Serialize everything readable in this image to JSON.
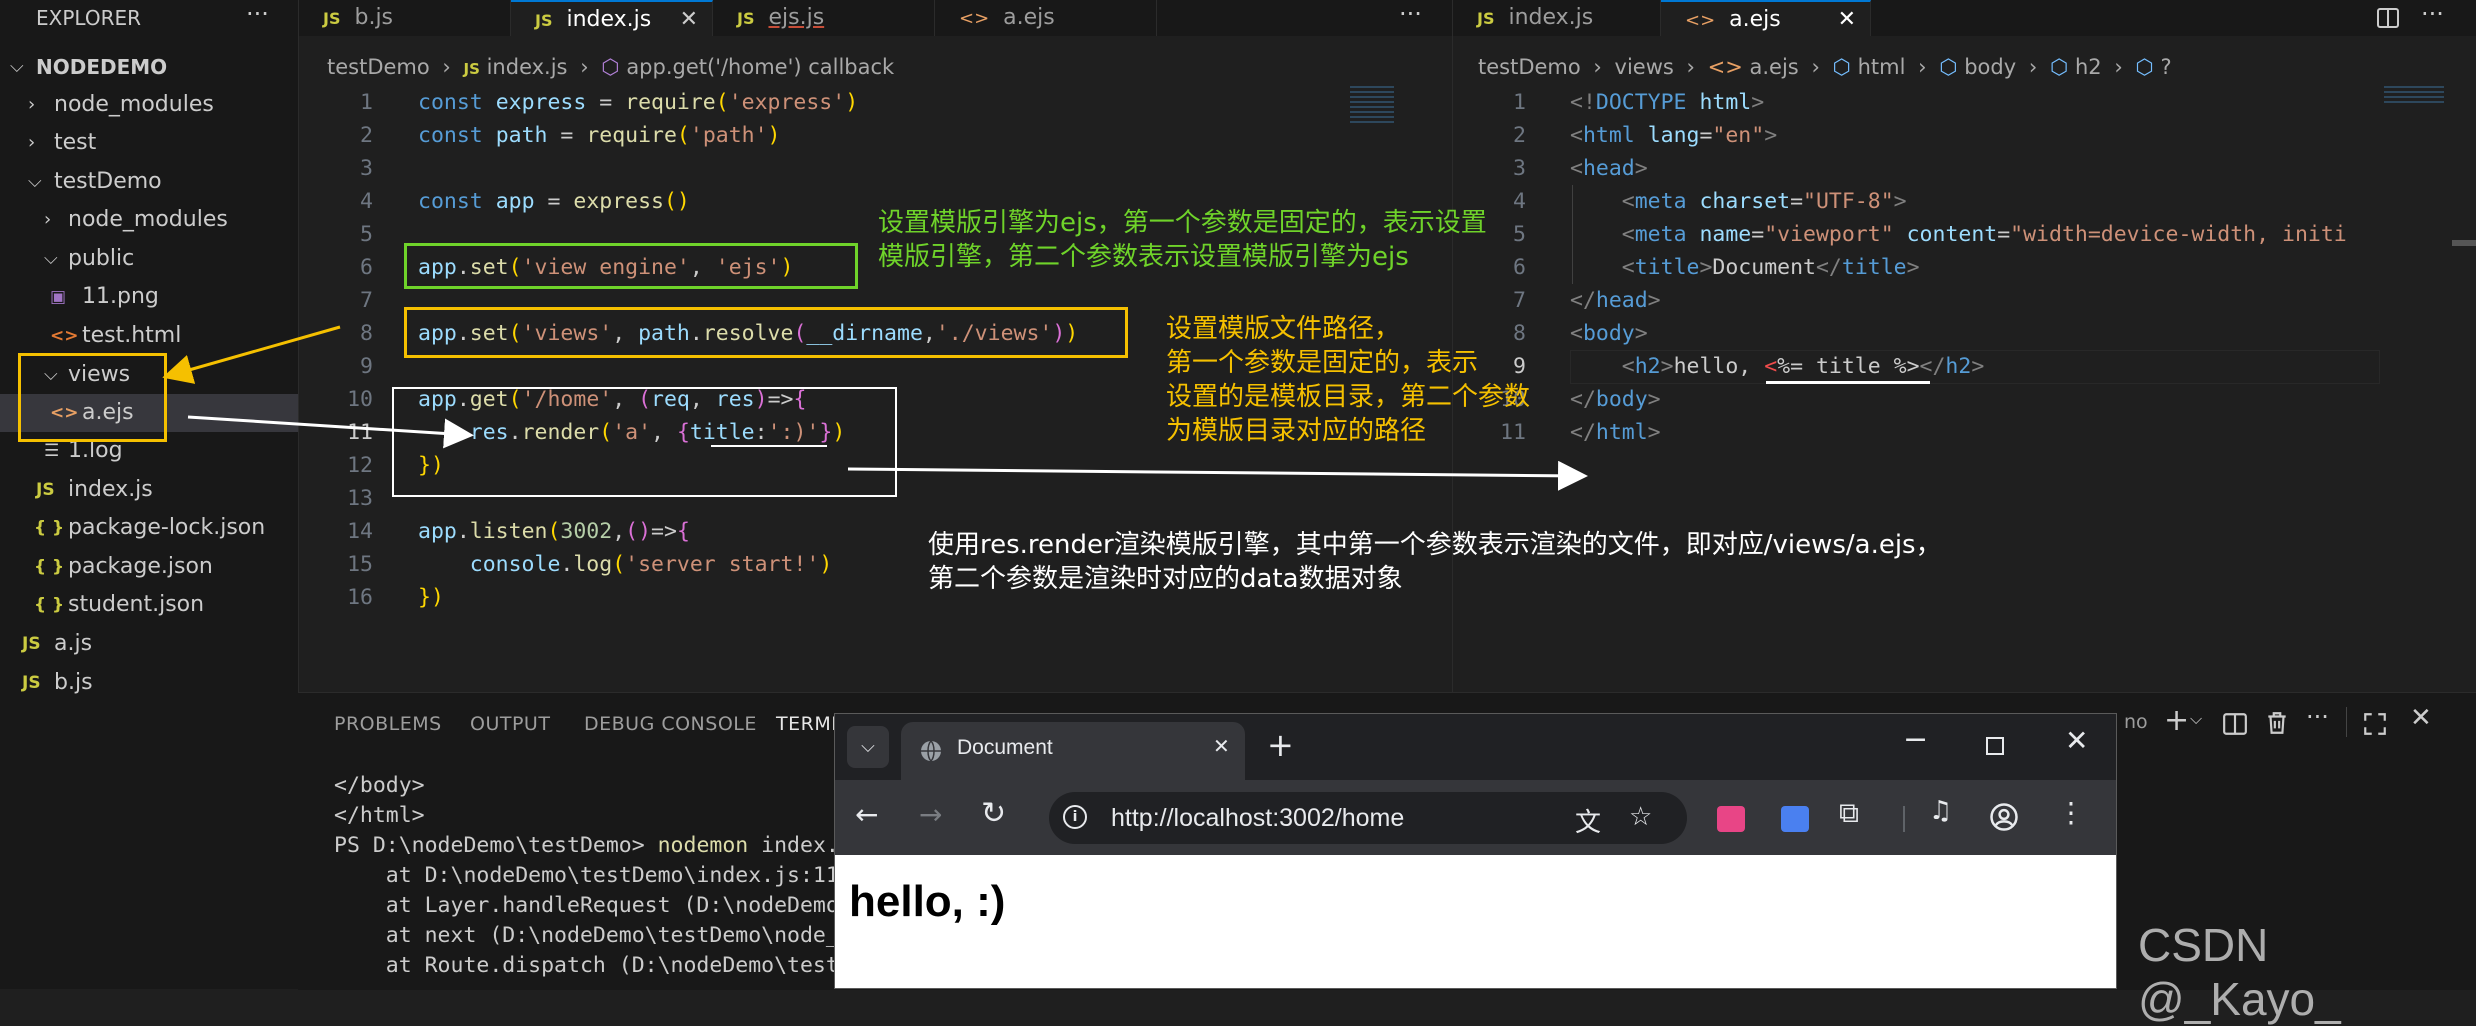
{
  "explorer": {
    "title": "EXPLORER",
    "more": "···",
    "root": "NODEDEMO",
    "items": [
      {
        "label": "node_modules",
        "type": "folder-closed"
      },
      {
        "label": "test",
        "type": "folder-closed"
      },
      {
        "label": "testDemo",
        "type": "folder-open"
      },
      {
        "label": "node_modules",
        "type": "folder-closed"
      },
      {
        "label": "public",
        "type": "folder-open"
      },
      {
        "label": "11.png",
        "type": "image"
      },
      {
        "label": "test.html",
        "type": "html"
      },
      {
        "label": "views",
        "type": "folder-open"
      },
      {
        "label": "a.ejs",
        "type": "ejs"
      },
      {
        "label": "1.log",
        "type": "log"
      },
      {
        "label": "index.js",
        "type": "js"
      },
      {
        "label": "package-lock.json",
        "type": "json"
      },
      {
        "label": "package.json",
        "type": "json"
      },
      {
        "label": "student.json",
        "type": "json"
      },
      {
        "label": "a.js",
        "type": "js"
      },
      {
        "label": "b.js",
        "type": "js"
      }
    ],
    "icon_glyphs": {
      "js": "JS",
      "json": "{ }",
      "ejs": "<>",
      "html": "<>",
      "log": "☰",
      "image": "▣"
    }
  },
  "left_editor": {
    "tabs": [
      "b.js",
      "index.js",
      "ejs.js",
      "a.ejs"
    ],
    "active_tab": "index.js",
    "close": "✕",
    "more": "···",
    "breadcrumb": {
      "folder": "testDemo",
      "file": "index.js",
      "symbol": "app.get('/home') callback"
    },
    "line_numbers": [
      "1",
      "2",
      "3",
      "4",
      "5",
      "6",
      "7",
      "8",
      "9",
      "10",
      "11",
      "12",
      "13",
      "14",
      "15",
      "16"
    ]
  },
  "right_editor": {
    "tabs": [
      "index.js",
      "a.ejs"
    ],
    "active_tab": "a.ejs",
    "close": "✕",
    "breadcrumb": {
      "folder1": "testDemo",
      "folder2": "views",
      "file": "a.ejs",
      "path": [
        "html",
        "body",
        "h2",
        "?"
      ]
    },
    "line_numbers": [
      "1",
      "2",
      "3",
      "4",
      "5",
      "6",
      "7",
      "8",
      "9",
      "10",
      "11"
    ]
  },
  "annotations": {
    "engine_note_1": "设置模版引擎为ejs，第一个参数是固定的，表示设置",
    "engine_note_2": "模版引擎，第二个参数表示设置模版引擎为ejs",
    "views_note_1": "设置模版文件路径，",
    "views_note_2": "第一个参数是固定的，表示",
    "views_note_3": "设置的是模板目录，第二个参数",
    "views_note_4": "为模版目录对应的路径",
    "render_note_1": "使用res.render渲染模版引擎，其中第一个参数表示渲染的文件，即对应/views/a.ejs，",
    "render_note_2": "第二个参数是渲染时对应的data数据对象"
  },
  "panel": {
    "tabs": [
      "PROBLEMS",
      "OUTPUT",
      "DEBUG CONSOLE",
      "TERMINAL"
    ],
    "active_tab": "TERMINAL",
    "right_label": "no",
    "terminal_lines": [
      "</body>",
      "</html>",
      "PS D:\\nodeDemo\\testDemo> nodemon index.",
      "    at D:\\nodeDemo\\testDemo\\index.js:11",
      "    at Layer.handleRequest (D:\\nodeDemo",
      "    at next (D:\\nodeDemo\\testDemo\\node_",
      "    at Route.dispatch (D:\\nodeDemo\\test"
    ]
  },
  "browser": {
    "tab_title": "Document",
    "url": "http://localhost:3002/home",
    "page_heading": "hello, :)"
  },
  "watermark": "CSDN @_Kayo_"
}
